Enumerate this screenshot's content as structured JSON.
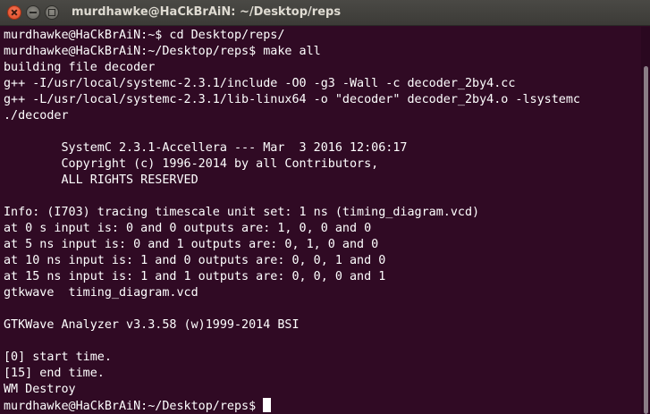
{
  "window": {
    "title": "murdhawke@HaCkBrAiN: ~/Desktop/reps"
  },
  "terminal": {
    "lines": [
      "murdhawke@HaCkBrAiN:~$ cd Desktop/reps/",
      "murdhawke@HaCkBrAiN:~/Desktop/reps$ make all",
      "building file decoder",
      "g++ -I/usr/local/systemc-2.3.1/include -O0 -g3 -Wall -c decoder_2by4.cc",
      "g++ -L/usr/local/systemc-2.3.1/lib-linux64 -o \"decoder\" decoder_2by4.o -lsystemc",
      "./decoder",
      "",
      "        SystemC 2.3.1-Accellera --- Mar  3 2016 12:06:17",
      "        Copyright (c) 1996-2014 by all Contributors,",
      "        ALL RIGHTS RESERVED",
      "",
      "Info: (I703) tracing timescale unit set: 1 ns (timing_diagram.vcd)",
      "at 0 s input is: 0 and 0 outputs are: 1, 0, 0 and 0",
      "at 5 ns input is: 0 and 1 outputs are: 0, 1, 0 and 0",
      "at 10 ns input is: 1 and 0 outputs are: 0, 0, 1 and 0",
      "at 15 ns input is: 1 and 1 outputs are: 0, 0, 0 and 1",
      "gtkwave  timing_diagram.vcd",
      "",
      "GTKWave Analyzer v3.3.58 (w)1999-2014 BSI",
      "",
      "[0] start time.",
      "[15] end time.",
      "WM Destroy"
    ],
    "prompt": "murdhawke@HaCkBrAiN:~/Desktop/reps$ "
  },
  "colors": {
    "background": "#300a24",
    "text": "#ffffff",
    "titlebar": "#3c3b37",
    "close_button": "#e0451e"
  },
  "icons": [
    "close-icon",
    "minimize-icon",
    "maximize-icon"
  ]
}
